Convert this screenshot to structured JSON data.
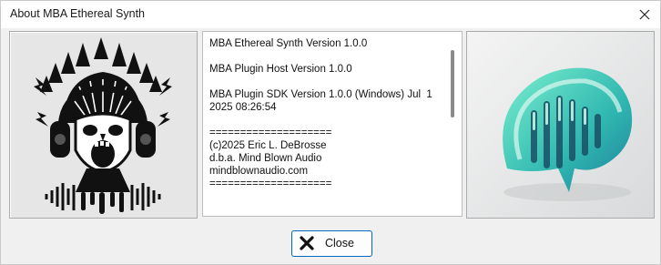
{
  "window": {
    "title": "About MBA Ethereal Synth"
  },
  "icons": {
    "window_close": "close-icon",
    "left_image": "screaming-skull-headphones-logo",
    "right_image": "teal-speech-bubble-soundwave-logo",
    "button_icon": "x-mark-icon"
  },
  "info": {
    "lines": [
      "MBA Ethereal Synth Version 1.0.0",
      "",
      "MBA Plugin Host Version 1.0.0",
      "",
      "MBA Plugin SDK Version 1.0.0 (Windows) Jul  1",
      "2025 08:26:54",
      "",
      "====================",
      "(c)2025 Eric L. DeBrosse",
      "d.b.a. Mind Blown Audio",
      "mindblownaudio.com",
      "===================="
    ]
  },
  "buttons": {
    "close_label": "Close"
  },
  "colors": {
    "accent": "#0067c0",
    "teal_light": "#5fe6c8",
    "teal_dark": "#1f8fa8"
  }
}
